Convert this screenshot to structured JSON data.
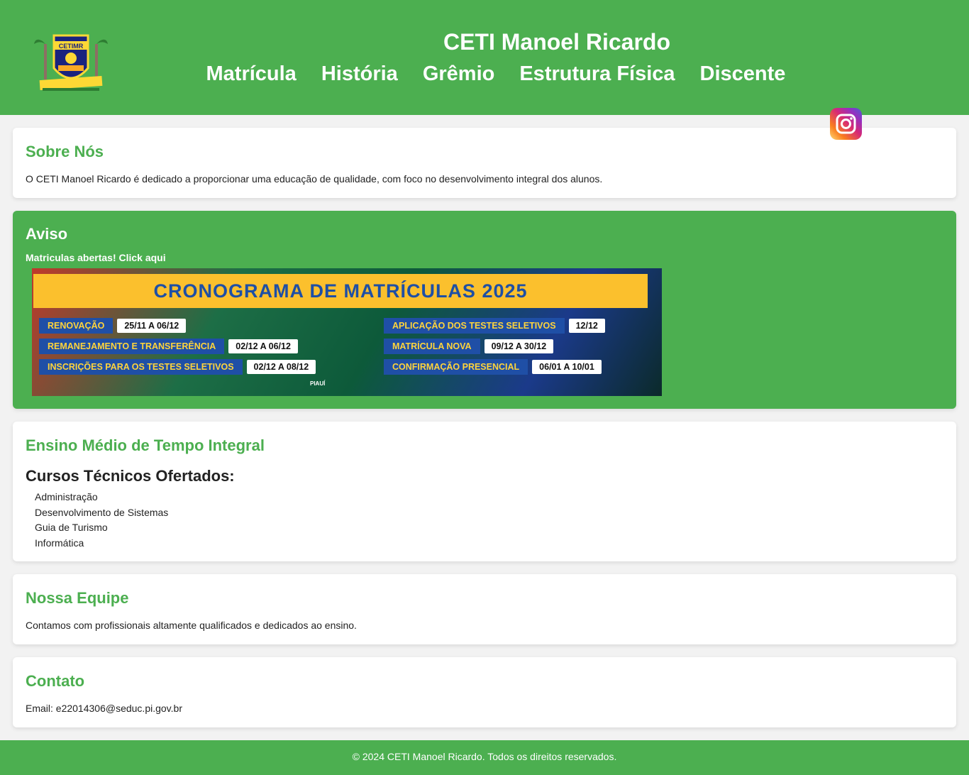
{
  "header": {
    "title": "CETI Manoel Ricardo",
    "logo_text": "CETIMR",
    "nav": [
      "Matrícula",
      "História",
      "Grêmio",
      "Estrutura Física",
      "Discente"
    ]
  },
  "icons": {
    "instagram": "instagram-icon"
  },
  "sobre": {
    "title": "Sobre Nós",
    "text": "O CETI Manoel Ricardo é dedicado a proporcionar uma educação de qualidade, com foco no desenvolvimento integral dos alunos."
  },
  "aviso": {
    "title": "Aviso",
    "link": "Matriculas abertas! Click aqui",
    "banner": {
      "title": "CRONOGRAMA DE MATRÍCULAS 2025",
      "left": [
        {
          "label": "RENOVAÇÃO",
          "date": "25/11 A 06/12"
        },
        {
          "label": "REMANEJAMENTO E TRANSFERÊNCIA",
          "date": "02/12 A 06/12"
        },
        {
          "label": "INSCRIÇÕES PARA OS TESTES SELETIVOS",
          "date": "02/12 A 08/12"
        }
      ],
      "right": [
        {
          "label": "APLICAÇÃO DOS TESTES SELETIVOS",
          "date": "12/12"
        },
        {
          "label": "MATRÍCULA NOVA",
          "date": "09/12 A 30/12"
        },
        {
          "label": "CONFIRMAÇÃO PRESENCIAL",
          "date": "06/01 A 10/01"
        }
      ],
      "footer_logo": "PIAUÍ"
    }
  },
  "ensino": {
    "title": "Ensino Médio de Tempo Integral",
    "subtitle": "Cursos Técnicos Ofertados:",
    "courses": [
      "Administração",
      "Desenvolvimento de Sistemas",
      "Guia de Turismo",
      "Informática"
    ]
  },
  "equipe": {
    "title": "Nossa Equipe",
    "text": "Contamos com profissionais altamente qualificados e dedicados ao ensino."
  },
  "contato": {
    "title": "Contato",
    "email": "Email: e22014306@seduc.pi.gov.br"
  },
  "footer": {
    "text": "© 2024 CETI Manoel Ricardo. Todos os direitos reservados."
  },
  "colors": {
    "brand_green": "#4caf50",
    "banner_yellow": "#fbc02d",
    "banner_blue": "#1f4fa6"
  }
}
